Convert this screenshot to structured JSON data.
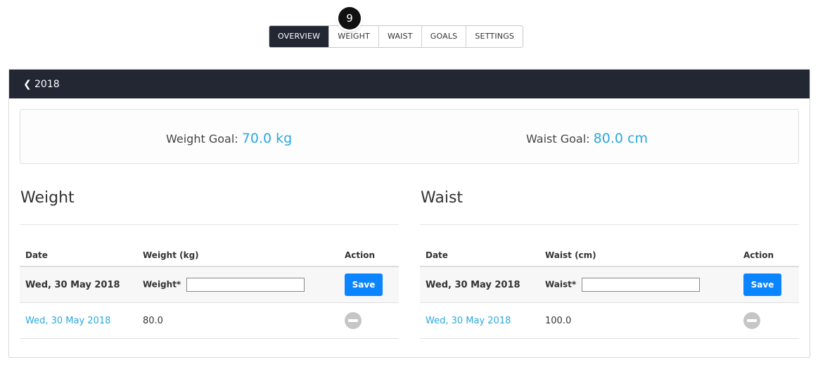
{
  "step_badge": "9",
  "tabs": [
    {
      "label": "OVERVIEW",
      "active": true
    },
    {
      "label": "WEIGHT",
      "active": false
    },
    {
      "label": "WAIST",
      "active": false
    },
    {
      "label": "GOALS",
      "active": false
    },
    {
      "label": "SETTINGS",
      "active": false
    }
  ],
  "header": {
    "year": "2018",
    "back_icon": "chevron-left-icon"
  },
  "goals": {
    "weight_label": "Weight Goal:",
    "weight_value": "70.0 kg",
    "waist_label": "Waist Goal:",
    "waist_value": "80.0 cm"
  },
  "weight": {
    "title": "Weight",
    "columns": [
      "Date",
      "Weight (kg)",
      "Action"
    ],
    "form": {
      "date": "Wed, 30 May 2018",
      "field_label": "Weight*",
      "value": "",
      "save_label": "Save"
    },
    "rows": [
      {
        "date": "Wed, 30 May 2018",
        "value": "80.0"
      }
    ]
  },
  "waist": {
    "title": "Waist",
    "columns": [
      "Date",
      "Waist (cm)",
      "Action"
    ],
    "form": {
      "date": "Wed, 30 May 2018",
      "field_label": "Waist*",
      "value": "",
      "save_label": "Save"
    },
    "rows": [
      {
        "date": "Wed, 30 May 2018",
        "value": "100.0"
      }
    ]
  },
  "colors": {
    "header_bg": "#222733",
    "accent": "#2aa8e0",
    "button": "#0a84ff"
  }
}
